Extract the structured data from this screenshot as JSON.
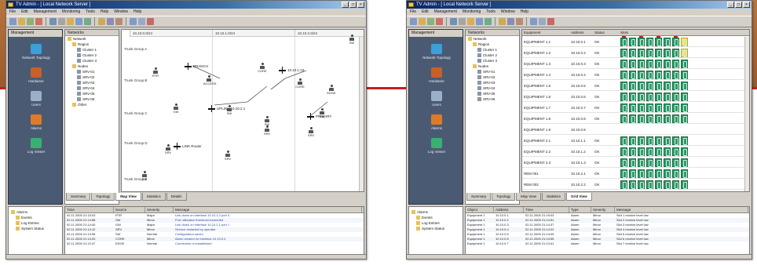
{
  "window_left": {
    "title": "TV Admin - [ Local Network Server ]",
    "menu": [
      "File",
      "Edit",
      "Management",
      "Monitoring",
      "Tools",
      "Help",
      "Window",
      "Help"
    ],
    "nav_header": "Management",
    "nav_items": [
      {
        "label": "Network Topology",
        "icon": "network-icon",
        "color": "#3aa0d8"
      },
      {
        "label": "Hardware",
        "icon": "hardware-icon",
        "color": "#c8602a"
      },
      {
        "label": "Users",
        "icon": "users-icon",
        "color": "#9ab0c8"
      },
      {
        "label": "Alarms",
        "icon": "alarm-icon",
        "color": "#e07a2a"
      },
      {
        "label": "Log Viewer",
        "icon": "log-icon",
        "color": "#3ab070"
      }
    ],
    "tree_header": "Networks",
    "tree": [
      {
        "label": "Network",
        "indent": 0
      },
      {
        "label": "Region",
        "indent": 1
      },
      {
        "label": "Cluster 1",
        "indent": 2
      },
      {
        "label": "Cluster 2",
        "indent": 2
      },
      {
        "label": "Cluster 3",
        "indent": 2
      },
      {
        "label": "Nodes",
        "indent": 1
      },
      {
        "label": "SRV-01",
        "indent": 2
      },
      {
        "label": "SRV-02",
        "indent": 2
      },
      {
        "label": "SRV-03",
        "indent": 2
      },
      {
        "label": "SRV-04",
        "indent": 2
      },
      {
        "label": "SRV-05",
        "indent": 2
      },
      {
        "label": "SRV-06",
        "indent": 2
      },
      {
        "label": "Other",
        "indent": 1
      }
    ],
    "topology": {
      "columns": [
        "10.10.0.0/24",
        "10.10.1.0/24",
        "10.10.2.0/24"
      ],
      "rows": [
        "Trunk Group A",
        "Trunk Group B",
        "Trunk Group C",
        "Trunk Group D",
        "Trunk Group E"
      ],
      "nodes": [
        "SW",
        "RTR",
        "ACCESS",
        "CORE",
        "CORE",
        "EDGE",
        "GW",
        "SW",
        "SW",
        "SW",
        "SRV",
        "SRV",
        "SRV",
        "SRV",
        "SW"
      ],
      "hubs": [
        "BRANCH",
        "10.10.1.10",
        "UPLINK 10.10.2.1",
        "PRIMARY",
        "LINK Router"
      ]
    },
    "tabs": [
      "Summary",
      "Topology",
      "Map View",
      "Statistics",
      "Details"
    ],
    "active_tab": "Map View",
    "lower_tree": [
      "Alarms",
      "Events",
      "Log Entries",
      "System Status"
    ],
    "log_columns": [
      "Time",
      "Source",
      "Severity",
      "Message"
    ],
    "log_rows": [
      [
        "02.11.2005 21:15:03",
        "RTR",
        "Major",
        "Link down on interface 10.10.1.2 port 3"
      ],
      [
        "02.11.2005 21:14:58",
        "SW",
        "Minor",
        "Port utilization threshold exceeded"
      ],
      [
        "02.11.2005 21:14:40",
        "GW",
        "Major",
        "Link down on interface 10.10.2.1 port 1"
      ],
      [
        "02.11.2005 21:14:12",
        "SRV",
        "Minor",
        "Service restarted by operator"
      ],
      [
        "02.11.2005 21:13:55",
        "SW",
        "Normal",
        "Configuration saved"
      ],
      [
        "02.11.2005 21:13:20",
        "CORE",
        "Minor",
        "Alarm cleared on interface 10.10.0.4"
      ],
      [
        "02.11.2005 21:12:47",
        "EDGE",
        "Normal",
        "Connection re-established"
      ]
    ]
  },
  "window_right": {
    "title": "TV Admin - [ Local Network Server ]",
    "menu": [
      "File",
      "Edit",
      "Management",
      "Monitoring",
      "Tools",
      "Window",
      "Help"
    ],
    "nav_header": "Management",
    "nav_items": [
      {
        "label": "Network Topology",
        "icon": "network-icon",
        "color": "#3aa0d8"
      },
      {
        "label": "Hardware",
        "icon": "hardware-icon",
        "color": "#c8602a"
      },
      {
        "label": "Users",
        "icon": "users-icon",
        "color": "#9ab0c8"
      },
      {
        "label": "Alarms",
        "icon": "alarm-icon",
        "color": "#e07a2a"
      },
      {
        "label": "Log Viewer",
        "icon": "log-icon",
        "color": "#3ab070"
      }
    ],
    "tree_header": "Networks",
    "tree": [
      {
        "label": "Network",
        "indent": 0
      },
      {
        "label": "Region",
        "indent": 1
      },
      {
        "label": "Cluster 1",
        "indent": 2
      },
      {
        "label": "Cluster 2",
        "indent": 2
      },
      {
        "label": "Cluster 3",
        "indent": 2
      },
      {
        "label": "Nodes",
        "indent": 1
      },
      {
        "label": "SRV-01",
        "indent": 2
      },
      {
        "label": "SRV-02",
        "indent": 2
      },
      {
        "label": "SRV-03",
        "indent": 2
      },
      {
        "label": "SRV-04",
        "indent": 2
      },
      {
        "label": "SRV-05",
        "indent": 2
      },
      {
        "label": "SRV-06",
        "indent": 2
      }
    ],
    "grid_columns": [
      "Equipment",
      "Address",
      "Status",
      "Slots"
    ],
    "grid_rows": [
      {
        "name": "EQUIPMENT 1.1",
        "addr": "10.10.0.1",
        "status": "OK",
        "cells": 8,
        "warn": [
          7
        ]
      },
      {
        "name": "EQUIPMENT 1.2",
        "addr": "10.10.0.2",
        "status": "OK",
        "cells": 8,
        "warn": [
          7
        ]
      },
      {
        "name": "EQUIPMENT 1.3",
        "addr": "10.10.0.3",
        "status": "OK",
        "cells": 8,
        "warn": []
      },
      {
        "name": "EQUIPMENT 1.4",
        "addr": "10.10.0.4",
        "status": "OK",
        "cells": 8,
        "warn": []
      },
      {
        "name": "EQUIPMENT 1.5",
        "addr": "10.10.0.5",
        "status": "OK",
        "cells": 8,
        "warn": []
      },
      {
        "name": "EQUIPMENT 1.6",
        "addr": "10.10.0.6",
        "status": "OK",
        "cells": 8,
        "warn": []
      },
      {
        "name": "EQUIPMENT 1.7",
        "addr": "10.10.0.7",
        "status": "OK",
        "cells": 8,
        "warn": []
      },
      {
        "name": "EQUIPMENT 1.8",
        "addr": "10.10.0.8",
        "status": "OK",
        "cells": 8,
        "warn": []
      },
      {
        "name": "EQUIPMENT 1.9",
        "addr": "10.10.0.9",
        "status": "",
        "cells": 0,
        "warn": []
      },
      {
        "name": "EQUIPMENT 2.1",
        "addr": "10.10.1.1",
        "status": "OK",
        "cells": 8,
        "warn": []
      },
      {
        "name": "EQUIPMENT 2.2",
        "addr": "10.10.1.2",
        "status": "OK",
        "cells": 8,
        "warn": []
      },
      {
        "name": "EQUIPMENT 2.3",
        "addr": "10.10.1.3",
        "status": "OK",
        "cells": 8,
        "warn": []
      },
      {
        "name": "REM 001",
        "addr": "10.10.2.1",
        "status": "OK",
        "cells": 8,
        "warn": []
      },
      {
        "name": "REM 002",
        "addr": "10.10.2.2",
        "status": "OK",
        "cells": 8,
        "warn": []
      }
    ],
    "tabs": [
      "Summary",
      "Topology",
      "Map View",
      "Statistics",
      "Grid View"
    ],
    "active_tab": "Grid View",
    "lower_tree": [
      "Alarms",
      "Events",
      "Log Entries",
      "System Status"
    ],
    "log_columns": [
      "Object",
      "Address",
      "Time",
      "Type",
      "Severity",
      "Message"
    ],
    "log_rows": [
      [
        "Equipment 1",
        "10.10.0.1",
        "02.11.2005 21:15:03",
        "Alarm",
        "Minor",
        "Slot 1 receive level low"
      ],
      [
        "Equipment 1",
        "10.10.0.2",
        "02.11.2005 21:14:51",
        "Alarm",
        "Minor",
        "Slot 2 receive level low"
      ],
      [
        "Equipment 1",
        "10.10.0.3",
        "02.11.2005 21:14:37",
        "Alarm",
        "Minor",
        "Slot 3 receive level low"
      ],
      [
        "Equipment 1",
        "10.10.0.4",
        "02.11.2005 21:14:22",
        "Alarm",
        "Minor",
        "Slot 4 receive level low"
      ],
      [
        "Equipment 1",
        "10.10.0.5",
        "02.11.2005 21:14:09",
        "Alarm",
        "Minor",
        "Slot 5 receive level low"
      ],
      [
        "Equipment 1",
        "10.10.0.6",
        "02.11.2005 21:13:55",
        "Alarm",
        "Minor",
        "Slot 6 receive level low"
      ],
      [
        "Equipment 1",
        "10.10.0.7",
        "02.11.2005 21:13:41",
        "Alarm",
        "Minor",
        "Slot 7 receive level low"
      ]
    ]
  },
  "colors": {
    "banner": "#a86430",
    "accent_line": "#c81e1e",
    "nav_bg": "#4b5a73",
    "cell_ok": "#2e9c6a",
    "cell_warn": "#f2e27a"
  }
}
